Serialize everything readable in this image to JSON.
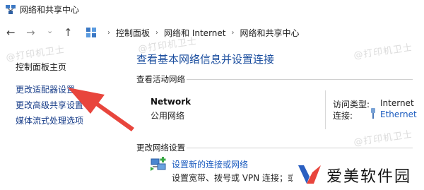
{
  "window": {
    "title": "网络和共享中心"
  },
  "nav": {
    "back_icon": "←",
    "forward_icon": "→",
    "recent_icon": "⌄",
    "up_icon": "↑"
  },
  "address": {
    "breadcrumbs": [
      "控制面板",
      "网络和 Internet",
      "网络和共享中心"
    ],
    "separator": "›"
  },
  "watermarks": [
    "@打印机卫士",
    "@打印机卫士",
    "@打印机卫士",
    "@打印机卫士"
  ],
  "sidebar": {
    "items": [
      {
        "label": "控制面板主页"
      },
      {
        "label": "更改适配器设置"
      },
      {
        "label": "更改高级共享设置"
      },
      {
        "label": "媒体流式处理选项"
      }
    ]
  },
  "main": {
    "title": "查看基本网络信息并设置连接",
    "active_networks_heading": "查看活动网络",
    "network": {
      "name": "Network",
      "type": "公用网络",
      "access_type_label": "访问类型:",
      "access_type_value": "Internet",
      "connections_label": "连接:",
      "connection_value": "Ethernet"
    },
    "change_settings_heading": "更改网络设置",
    "setup": {
      "link": "设置新的连接或网络",
      "description": "设置宽带、拨号或 VPN 连接；或"
    }
  },
  "overlay": {
    "logo_text": "爱美软件园",
    "arrow_color": "#e8453c"
  },
  "colors": {
    "link": "#1a5bbf",
    "title": "#1a4d9e",
    "sidebar_link": "#1a3f8a"
  }
}
